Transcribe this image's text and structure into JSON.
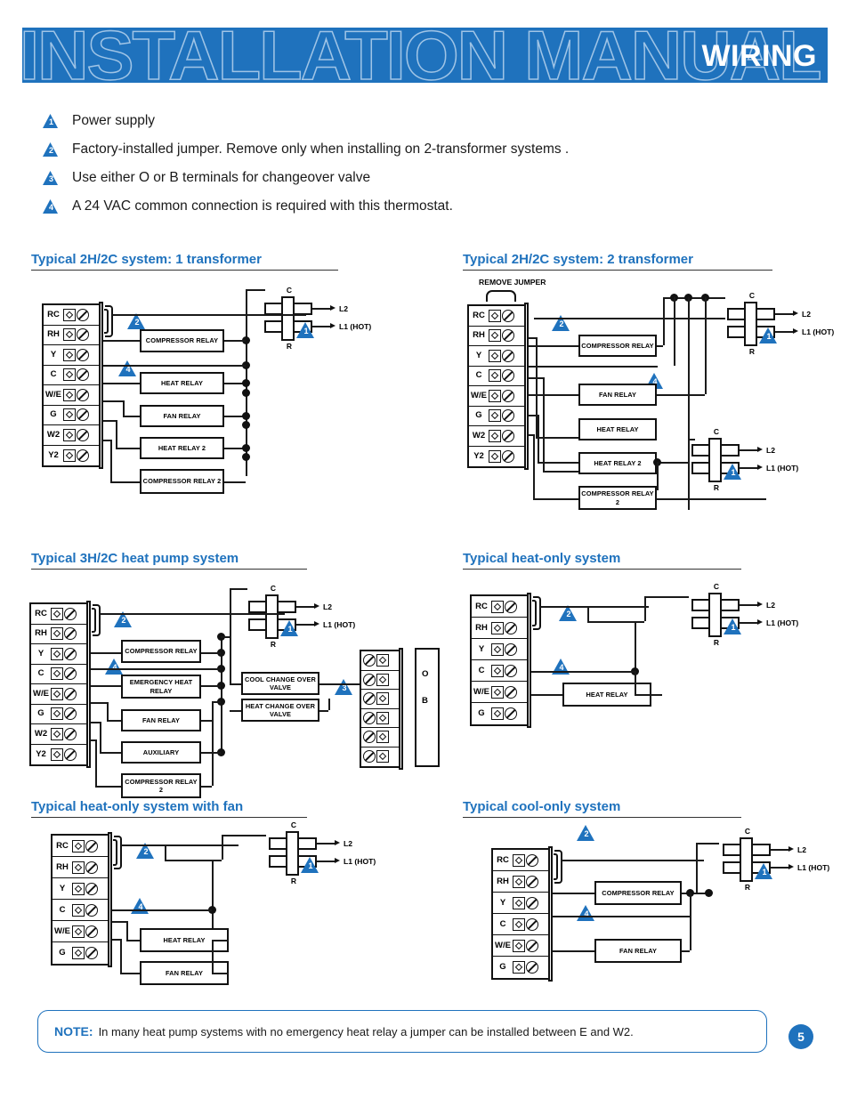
{
  "header": {
    "ghost_title": "INSTALLATION MANUAL",
    "section_label": "WIRING",
    "banner_color": "#1f72bd",
    "ghost_outline_color": "#9fc4e6"
  },
  "legend": [
    {
      "num": "1",
      "text": "Power supply"
    },
    {
      "num": "2",
      "text": "Factory-installed jumper. Remove only when installing on 2-transformer systems  ."
    },
    {
      "num": "3",
      "text": "Use either O or B terminals for changeover valve"
    },
    {
      "num": "4",
      "text": "A 24 VAC common connection is required with this thermostat."
    }
  ],
  "diagrams": {
    "d1": {
      "title": "Typical 2H/2C system: 1 transformer",
      "terminals": [
        "RC",
        "RH",
        "Y",
        "C",
        "W/E",
        "G",
        "W2",
        "Y2"
      ],
      "relays": [
        "COMPRESSOR RELAY",
        "HEAT RELAY",
        "FAN RELAY",
        "HEAT RELAY 2",
        "COMPRESSOR RELAY 2"
      ],
      "transformer": {
        "top": "C",
        "bottom": "R",
        "out1": "L2",
        "out2": "L1 (HOT)"
      },
      "badges": [
        "2",
        "4",
        "1"
      ]
    },
    "d2": {
      "title": "Typical 2H/2C system: 2 transformer",
      "remove_jumper_label": "REMOVE JUMPER",
      "terminals": [
        "RC",
        "RH",
        "Y",
        "C",
        "W/E",
        "G",
        "W2",
        "Y2"
      ],
      "relays": [
        "COMPRESSOR RELAY",
        "FAN RELAY",
        "HEAT RELAY",
        "HEAT RELAY 2",
        "COMPRESSOR RELAY 2"
      ],
      "transformer": {
        "top": "C",
        "bottom": "R",
        "out1": "L2",
        "out2": "L1 (HOT)"
      },
      "transformer2": {
        "top": "C",
        "bottom": "R",
        "out1": "L2",
        "out2": "L1 (HOT)"
      },
      "badges": [
        "2",
        "4",
        "1",
        "1"
      ]
    },
    "d3": {
      "title": "Typical 3H/2C heat pump system",
      "terminals": [
        "RC",
        "RH",
        "Y",
        "C",
        "W/E",
        "G",
        "W2",
        "Y2"
      ],
      "relays": [
        "COMPRESSOR RELAY",
        "EMERGENCY HEAT RELAY",
        "FAN RELAY",
        "AUXILIARY",
        "COMPRESSOR RELAY 2"
      ],
      "valves": [
        "COOL CHANGE OVER VALVE",
        "HEAT CHANGE OVER VALVE"
      ],
      "valve_terminals": {
        "rows": 6,
        "o_label": "O",
        "b_label": "B"
      },
      "transformer": {
        "top": "C",
        "bottom": "R",
        "out1": "L2",
        "out2": "L1 (HOT)"
      },
      "badges": [
        "2",
        "4",
        "1",
        "3"
      ]
    },
    "d4": {
      "title": "Typical heat-only system",
      "terminals": [
        "RC",
        "RH",
        "Y",
        "C",
        "W/E",
        "G"
      ],
      "relays": [
        "HEAT RELAY"
      ],
      "transformer": {
        "top": "C",
        "bottom": "R",
        "out1": "L2",
        "out2": "L1 (HOT)"
      },
      "badges": [
        "2",
        "4",
        "1"
      ]
    },
    "d5": {
      "title": "Typical heat-only system with fan",
      "terminals": [
        "RC",
        "RH",
        "Y",
        "C",
        "W/E",
        "G"
      ],
      "relays": [
        "HEAT RELAY",
        "FAN RELAY"
      ],
      "transformer": {
        "top": "C",
        "bottom": "R",
        "out1": "L2",
        "out2": "L1 (HOT)"
      },
      "badges": [
        "2",
        "4",
        "1"
      ]
    },
    "d6": {
      "title": "Typical cool-only system",
      "terminals": [
        "RC",
        "RH",
        "Y",
        "C",
        "W/E",
        "G"
      ],
      "relays": [
        "COMPRESSOR RELAY",
        "FAN RELAY"
      ],
      "transformer": {
        "top": "C",
        "bottom": "R",
        "out1": "L2",
        "out2": "L1 (HOT)"
      },
      "badges": [
        "2",
        "4",
        "1"
      ]
    }
  },
  "note": {
    "keyword": "NOTE:",
    "text": "In many heat pump systems with no emergency heat relay a jumper can be installed between E and W2."
  },
  "page_number": "5"
}
